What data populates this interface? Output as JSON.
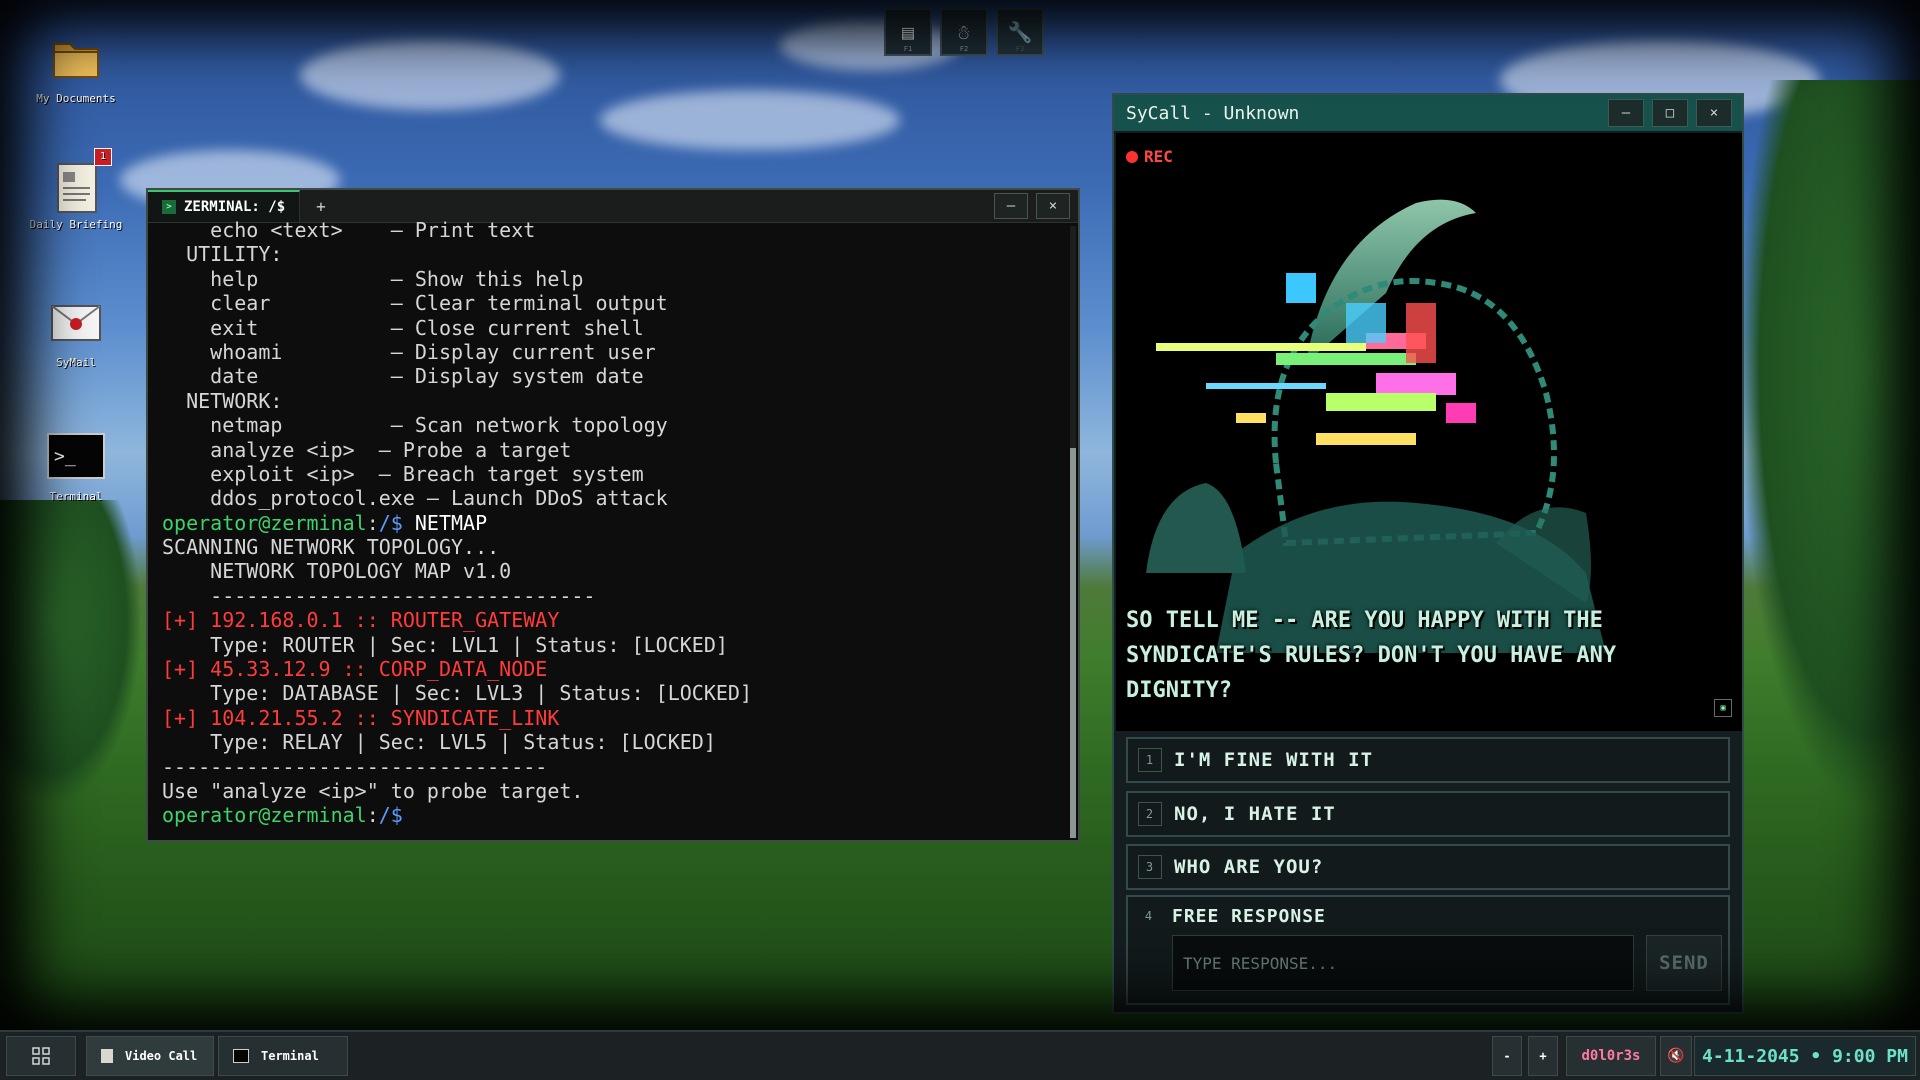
{
  "desktop": {
    "icons": [
      {
        "label": "My Documents",
        "icon": "folder-icon"
      },
      {
        "label": "Daily Briefing",
        "icon": "document-icon",
        "badge": "1"
      },
      {
        "label": "SyMail",
        "icon": "mail-icon"
      },
      {
        "label": "Terminal",
        "icon": "terminal-icon"
      }
    ]
  },
  "topdock": [
    {
      "icon": "notes-icon",
      "key": "F1"
    },
    {
      "icon": "robot-icon",
      "key": "F2"
    },
    {
      "icon": "wrench-icon",
      "key": "F3"
    }
  ],
  "terminal": {
    "tab_label": "ZERMINAL: /$",
    "add_tab": "+",
    "minimize": "–",
    "close": "×",
    "lines": [
      [
        {
          "t": "    echo <text>    — Print text",
          "c": ""
        }
      ],
      [
        {
          "t": "  UTILITY:",
          "c": ""
        }
      ],
      [
        {
          "t": "    help           — Show this help",
          "c": ""
        }
      ],
      [
        {
          "t": "    clear          — Clear terminal output",
          "c": ""
        }
      ],
      [
        {
          "t": "    exit           — Close current shell",
          "c": ""
        }
      ],
      [
        {
          "t": "    whoami         — Display current user",
          "c": ""
        }
      ],
      [
        {
          "t": "    date           — Display system date",
          "c": ""
        }
      ],
      [
        {
          "t": "  NETWORK:",
          "c": ""
        }
      ],
      [
        {
          "t": "    netmap         — Scan network topology",
          "c": ""
        }
      ],
      [
        {
          "t": "    analyze <ip>  — Probe a target",
          "c": ""
        }
      ],
      [
        {
          "t": "    exploit <ip>  — Breach target system",
          "c": ""
        }
      ],
      [
        {
          "t": "    ddos_protocol.exe — Launch DDoS attack",
          "c": ""
        }
      ],
      [
        {
          "t": "operator@zerminal",
          "c": "g"
        },
        {
          "t": ":",
          "c": ""
        },
        {
          "t": "/$",
          "c": "b"
        },
        {
          "t": " NETMAP",
          "c": "w"
        }
      ],
      [
        {
          "t": "SCANNING NETWORK TOPOLOGY...",
          "c": ""
        }
      ],
      [
        {
          "t": "    NETWORK TOPOLOGY MAP v1.0",
          "c": ""
        }
      ],
      [
        {
          "t": "    --------------------------------",
          "c": ""
        }
      ],
      [
        {
          "t": "[+] 192.168.0.1 :: ROUTER_GATEWAY",
          "c": "r"
        }
      ],
      [
        {
          "t": "    Type: ROUTER | Sec: LVL1 | Status: [LOCKED]",
          "c": ""
        }
      ],
      [
        {
          "t": "[+] 45.33.12.9 :: CORP_DATA_NODE",
          "c": "r"
        }
      ],
      [
        {
          "t": "    Type: DATABASE | Sec: LVL3 | Status: [LOCKED]",
          "c": ""
        }
      ],
      [
        {
          "t": "[+] 104.21.55.2 :: SYNDICATE_LINK",
          "c": "r"
        }
      ],
      [
        {
          "t": "    Type: RELAY | Sec: LVL5 | Status: [LOCKED]",
          "c": ""
        }
      ],
      [
        {
          "t": "--------------------------------",
          "c": ""
        }
      ],
      [
        {
          "t": "Use \"analyze <ip>\" to probe target.",
          "c": ""
        }
      ],
      [
        {
          "t": "operator@zerminal",
          "c": "g"
        },
        {
          "t": ":",
          "c": ""
        },
        {
          "t": "/$",
          "c": "b"
        }
      ]
    ]
  },
  "sycall": {
    "title": "SyCall - Unknown",
    "minimize": "–",
    "maximize": "□",
    "close": "×",
    "rec_label": "REC",
    "subtitle": "SO TELL ME -- ARE YOU HAPPY WITH THE SYNDICATE'S RULES? DON'T YOU HAVE ANY DIGNITY?",
    "options": [
      {
        "num": "1",
        "label": "I'M FINE WITH IT"
      },
      {
        "num": "2",
        "label": "NO, I HATE IT"
      },
      {
        "num": "3",
        "label": "WHO ARE YOU?"
      }
    ],
    "free": {
      "num": "4",
      "label": "FREE RESPONSE",
      "placeholder": "TYPE RESPONSE...",
      "value": "",
      "send": "SEND"
    }
  },
  "taskbar": {
    "start_icon": "grid-icon",
    "apps": [
      {
        "label": "Video Call",
        "icon": "document-icon"
      },
      {
        "label": "Terminal",
        "icon": "terminal-icon"
      }
    ],
    "zoom_out": "-",
    "zoom_in": "+",
    "user": "d0l0r3s",
    "volume_icon": "muted-speaker-icon",
    "clock": "4-11-2045 • 9:00 PM"
  },
  "colors": {
    "prompt": "#3ed26a",
    "path": "#5f9bff",
    "alert": "#ff3b3b",
    "accent": "#17514c",
    "clock": "#6fe0c8"
  }
}
